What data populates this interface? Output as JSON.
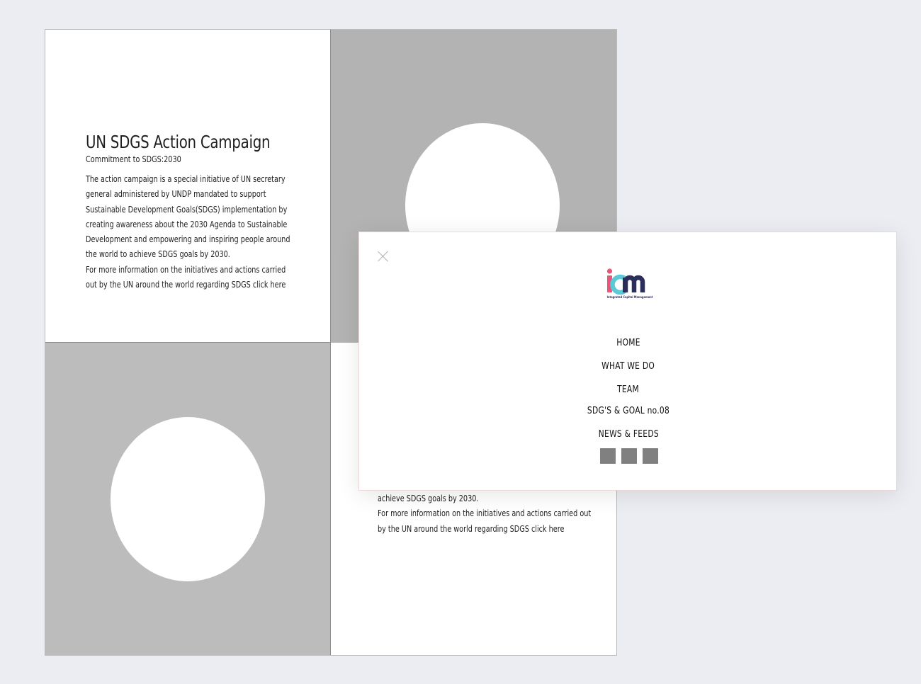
{
  "campaign": {
    "title": "UN SDGS Action Campaign",
    "subtitle": "Commitment to SDGS:2030",
    "body": "The action campaign is a special initiative of UN secretary general administered by UNDP mandated to support Sustainable Development Goals(SDGS) implementation by creating awareness about the 2030 Agenda to Sustainable Development and empowering and inspiring people around the world to achieve SDGS goals by 2030.",
    "more": "For more information on the initiatives and actions carried out by the UN around the world regarding SDGS click here"
  },
  "campaign_partial": {
    "line1": "achieve SDGS goals by 2030.",
    "line2": "For more information on the initiatives and actions carried out",
    "line3": "by the UN around the world regarding SDGS click here"
  },
  "menu": {
    "close_icon": "close-icon",
    "logo": {
      "text": "icm",
      "tagline": "Integrated Capital Management",
      "colors": {
        "i": "#e8577a",
        "c": "#5bc9d6",
        "m": "#2b2d5a"
      }
    },
    "items": [
      "HOME",
      "WHAT WE DO",
      "TEAM",
      "SDG'S & GOAL no.08",
      "NEWS & FEEDS"
    ],
    "social_icons": [
      "social-icon-1",
      "social-icon-2",
      "social-icon-3"
    ],
    "social_color": "#808080"
  },
  "colors": {
    "background": "#ecedf2",
    "placeholder_gray": "#b3b3b3",
    "placeholder_gray_2": "#bcbcbc"
  }
}
